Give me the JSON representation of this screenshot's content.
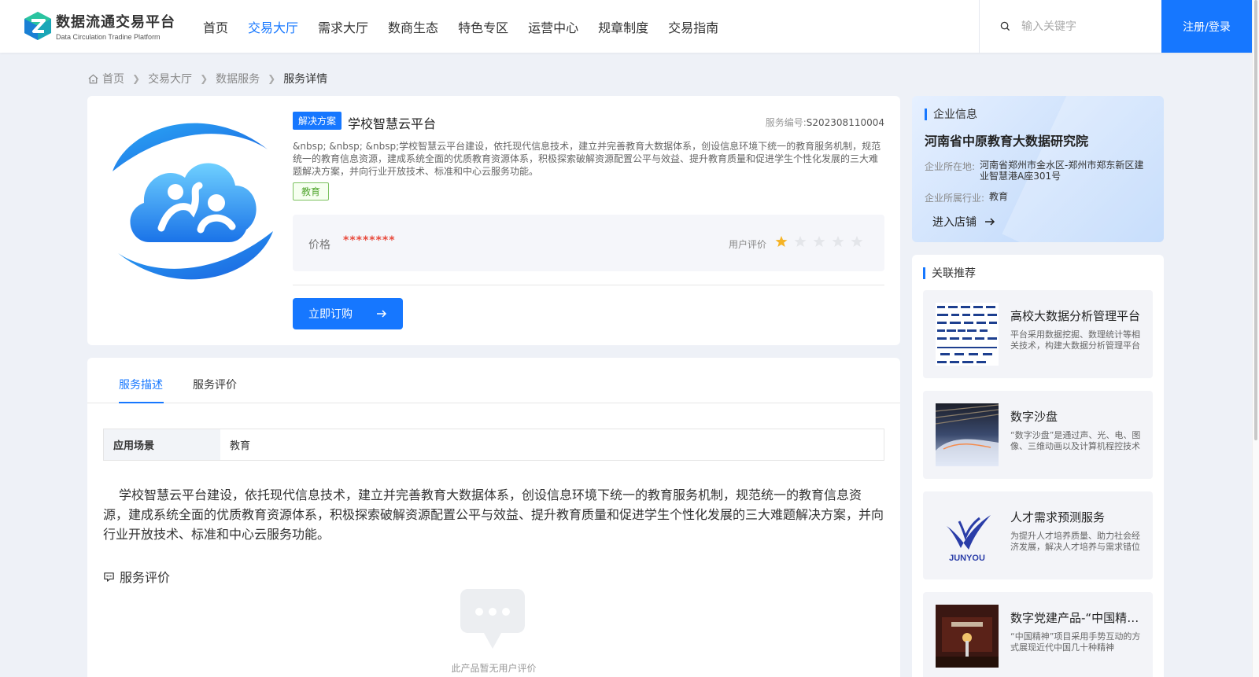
{
  "header": {
    "logo_cn": "数据流通交易平台",
    "logo_en": "Data Circulation Tradine Platform",
    "nav": [
      {
        "label": "首页",
        "active": false
      },
      {
        "label": "交易大厅",
        "active": true
      },
      {
        "label": "需求大厅",
        "active": false
      },
      {
        "label": "数商生态",
        "active": false
      },
      {
        "label": "特色专区",
        "active": false
      },
      {
        "label": "运营中心",
        "active": false
      },
      {
        "label": "规章制度",
        "active": false
      },
      {
        "label": "交易指南",
        "active": false
      }
    ],
    "search_placeholder": "输入关键字",
    "login_label": "注册/登录"
  },
  "breadcrumb": {
    "home": "首页",
    "level1": "交易大厅",
    "level2": "数据服务",
    "current": "服务详情"
  },
  "product": {
    "tag": "解决方案",
    "title": "学校智慧云平台",
    "service_no_label": "服务编号:",
    "service_no": "S202308110004",
    "desc": "&nbsp; &nbsp; &nbsp;学校智慧云平台建设，依托现代信息技术，建立并完善教育大数据体系，创设信息环境下统一的教育服务机制，规范统一的教育信息资源，建成系统全面的优质教育资源体系，积极探索破解资源配置公平与效益、提升教育质量和促进学生个性化发展的三大难题解决方案，并向行业开放技术、标准和中心云服务功能。",
    "category_tag": "教育",
    "price_label": "价格",
    "price_value": "********",
    "rating_label": "用户评价",
    "rating": 1,
    "rating_max": 5,
    "subscribe_label": "立即订购"
  },
  "colors": {
    "accent": "#1677ff",
    "price": "#e84a3c",
    "star_on": "#f5b325",
    "star_off": "#e4e6ea"
  },
  "tabs": {
    "describe": "服务描述",
    "review": "服务评价"
  },
  "detail": {
    "scene_key": "应用场景",
    "scene_val": "教育",
    "desc": "学校智慧云平台建设，依托现代信息技术，建立并完善教育大数据体系，创设信息环境下统一的教育服务机制，规范统一的教育信息资源，建成系统全面的优质教育资源体系，积极探索破解资源配置公平与效益、提升教育质量和促进学生个性化发展的三大难题解决方案，并向行业开放技术、标准和中心云服务功能。",
    "review_title": "服务评价",
    "empty_text": "此产品暂无用户评价"
  },
  "company": {
    "section_title": "企业信息",
    "name": "河南省中原教育大数据研究院",
    "address_label": "企业所在地:",
    "address": "河南省郑州市金水区-郑州市郑东新区建业智慧港A座301号",
    "industry_label": "企业所属行业:",
    "industry": "教育",
    "shop_label": "进入店铺"
  },
  "related": {
    "section_title": "关联推荐",
    "items": [
      {
        "title": "高校大数据分析管理平台",
        "desc": "平台采用数据挖掘、数理统计等相关技术，构建大数据分析管理平台",
        "thumb": "diagram"
      },
      {
        "title": "数字沙盘",
        "desc": "“数字沙盘”是通过声、光、电、图像、三维动画以及计算机程控技术",
        "thumb": "sandtable"
      },
      {
        "title": "人才需求预测服务",
        "desc": "为提升人才培养质量、助力社会经济发展，解决人才培养与需求错位问题",
        "thumb": "junyou",
        "thumb_text": "JUNYOU"
      },
      {
        "title": "数字党建产品-“中国精神”",
        "desc": "“中国精神”项目采用手势互动的方式展现近代中国几十种精神",
        "thumb": "hall"
      }
    ]
  }
}
